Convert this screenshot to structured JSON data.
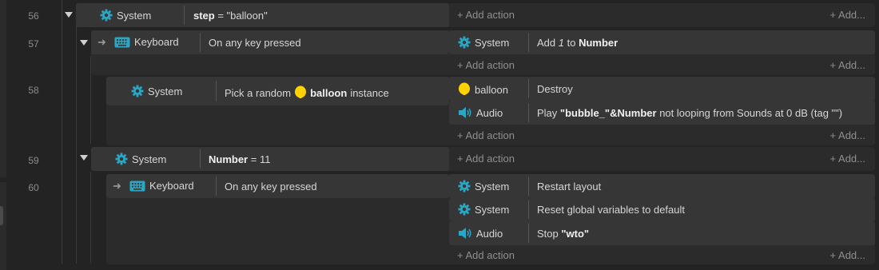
{
  "lines": [
    {
      "num": "56",
      "condition": {
        "object": "System",
        "icon": "gear-icon",
        "prefix": "step",
        "suffix": " = \"balloon\""
      },
      "add_action": "Add action",
      "add_more": "Add..."
    },
    {
      "num": "57",
      "condition": {
        "object": "Keyboard",
        "icon": "keyboard-icon",
        "text": "On any key pressed"
      },
      "actions": [
        {
          "object": "System",
          "icon": "gear-icon",
          "pre": "Add ",
          "italic": "1",
          "mid": " to ",
          "bold": "Number"
        }
      ],
      "add_action": "Add action",
      "add_more": "Add..."
    },
    {
      "num": "58",
      "condition": {
        "object": "System",
        "icon": "gear-icon",
        "pre": "Pick a random ",
        "bold": "balloon",
        "post": " instance"
      },
      "actions": [
        {
          "object": "balloon",
          "icon": "balloon-icon",
          "text": "Destroy"
        },
        {
          "object": "Audio",
          "icon": "speaker-icon",
          "pre": "Play ",
          "bold": "\"bubble_\"&Number",
          "post": " not looping from Sounds at 0 dB (tag \"\")"
        }
      ],
      "add_action": "Add action",
      "add_more": "Add..."
    },
    {
      "num": "59",
      "condition": {
        "object": "System",
        "icon": "gear-icon",
        "prefix": "Number",
        "suffix": " = 11"
      },
      "add_action": "Add action",
      "add_more": "Add..."
    },
    {
      "num": "60",
      "condition": {
        "object": "Keyboard",
        "icon": "keyboard-icon",
        "text": "On any key pressed"
      },
      "actions": [
        {
          "object": "System",
          "icon": "gear-icon",
          "text": "Restart layout"
        },
        {
          "object": "System",
          "icon": "gear-icon",
          "text": "Reset global variables to default"
        },
        {
          "object": "Audio",
          "icon": "speaker-icon",
          "pre": "Stop ",
          "bold": "\"wto\""
        }
      ],
      "add_action": "Add action",
      "add_more": "Add..."
    }
  ],
  "colors": {
    "icon_teal": "#2ba7c6",
    "balloon_yellow": "#ffd200",
    "background": "#232323",
    "block": "#2b2b2b",
    "row": "#363636"
  },
  "icons": {
    "plus": "+",
    "trigger_arrow": "➜"
  }
}
